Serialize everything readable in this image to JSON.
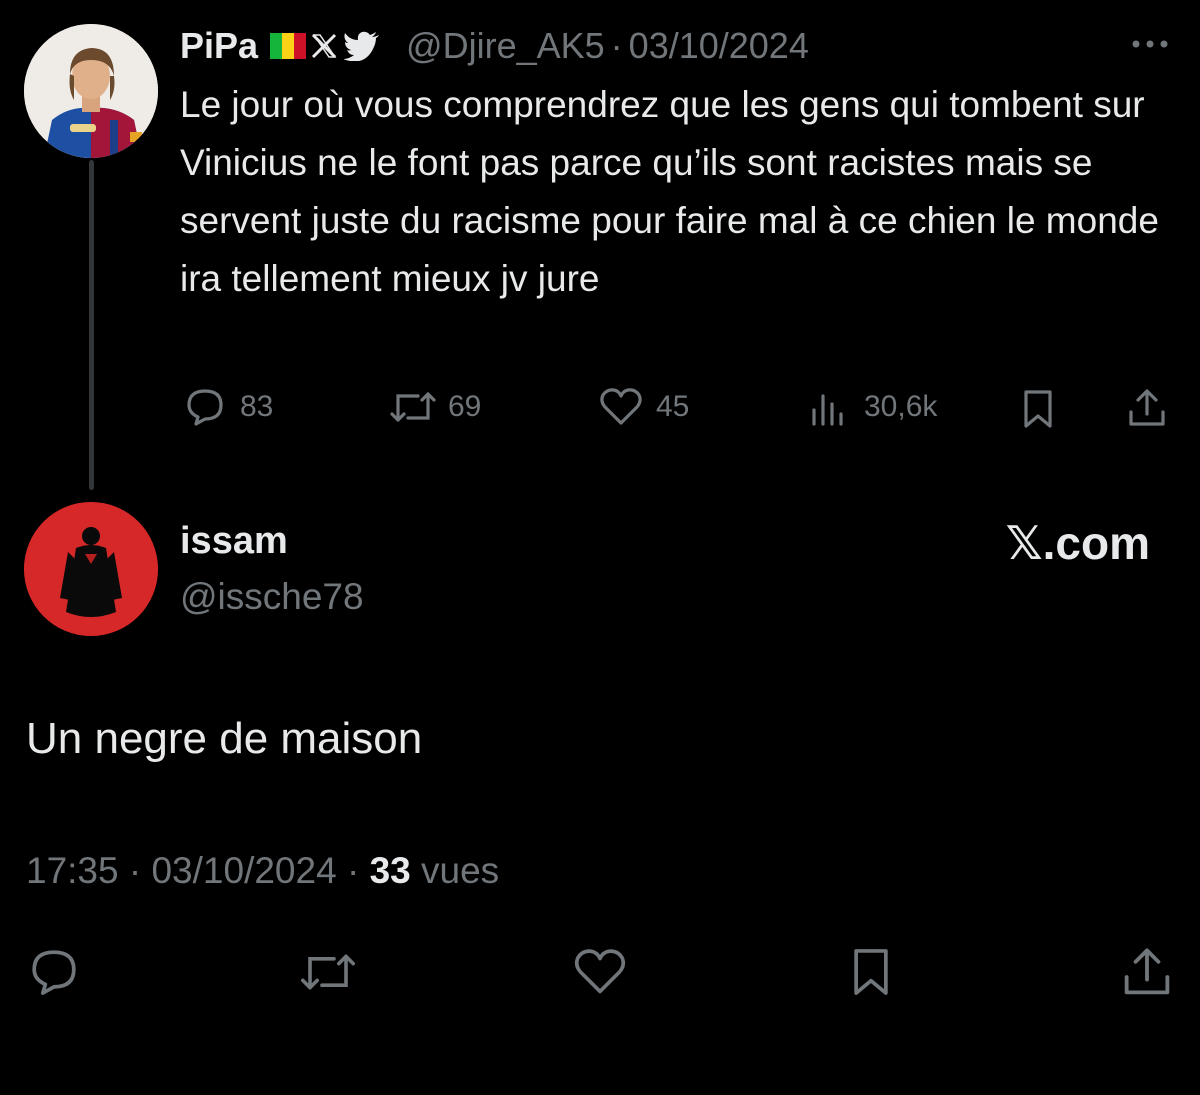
{
  "parent_tweet": {
    "author_name": "PiPa",
    "handle": "@Djire_AK5",
    "separator": "·",
    "date": "03/10/2024",
    "text": "Le jour où vous comprendrez que les gens qui tombent sur Vinicius ne le font pas parce qu’ils sont racistes mais se servent juste du racisme pour faire mal à ce chien le monde ira tellement mieux jv jure",
    "actions": {
      "replies": "83",
      "reposts": "69",
      "likes": "45",
      "views": "30,6k"
    },
    "badge_icons": [
      "mali-flag-icon",
      "x-logo-icon",
      "twitter-bird-icon"
    ]
  },
  "reply_tweet": {
    "author_name": "issam",
    "handle": "@issche78",
    "watermark": "𝕏.com",
    "text": "Un negre de maison",
    "time": "17:35",
    "separator": "·",
    "date": "03/10/2024",
    "separator2": "·",
    "views_count": "33",
    "views_label": "vues"
  },
  "colors": {
    "background": "#000000",
    "text": "#e7e9ea",
    "muted": "#71767b",
    "avatar_red": "#d62828"
  }
}
